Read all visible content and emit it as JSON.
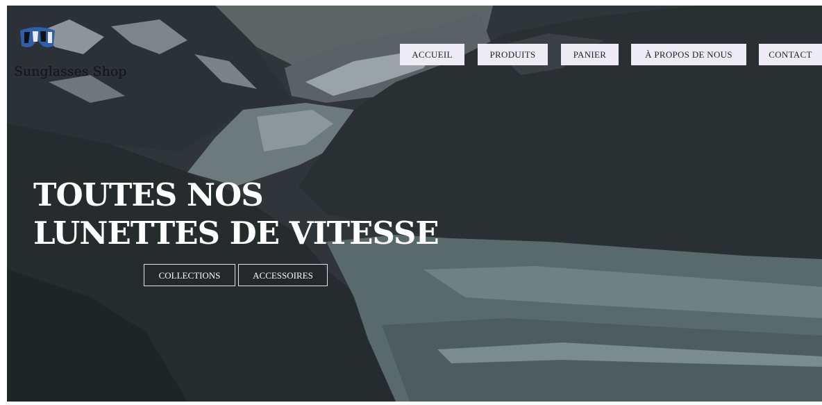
{
  "brand": {
    "name": "Sunglasses Shop",
    "logo_icon": "goggles-icon"
  },
  "nav": {
    "items": [
      {
        "label": "ACCUEIL"
      },
      {
        "label": "PRODUITS"
      },
      {
        "label": "PANIER"
      },
      {
        "label": "À PROPOS DE NOUS"
      },
      {
        "label": "CONTACT"
      }
    ]
  },
  "hero": {
    "headline_line1": "TOUTES NOS",
    "headline_line2": "LUNETTES DE VITESSE",
    "buttons": [
      {
        "label": "COLLECTIONS"
      },
      {
        "label": "ACCESSOIRES"
      }
    ]
  },
  "colors": {
    "nav_bg": "#eeeaf6",
    "nav_text": "#1f1f2a",
    "hero_text": "#ffffff",
    "logo_blue": "#2f5fa8"
  }
}
